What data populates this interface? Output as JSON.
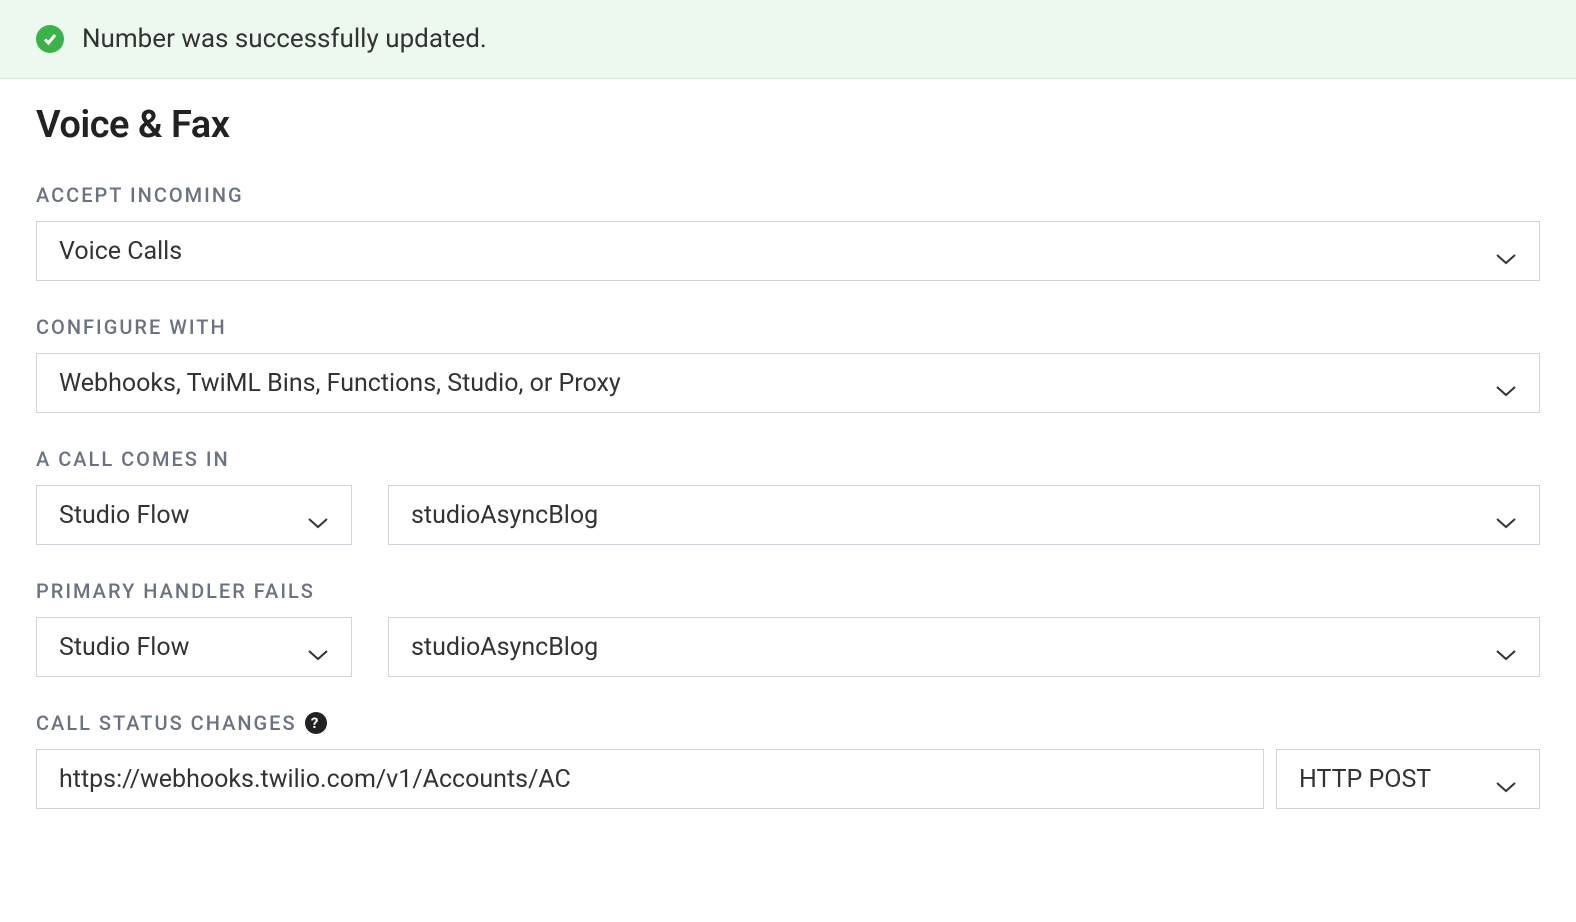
{
  "alert": {
    "message": "Number was successfully updated."
  },
  "section": {
    "title": "Voice & Fax"
  },
  "accept_incoming": {
    "label": "ACCEPT INCOMING",
    "value": "Voice Calls"
  },
  "configure_with": {
    "label": "CONFIGURE WITH",
    "value": "Webhooks, TwiML Bins, Functions, Studio, or Proxy"
  },
  "call_comes_in": {
    "label": "A CALL COMES IN",
    "handler_type": "Studio Flow",
    "handler_value": "studioAsyncBlog"
  },
  "primary_handler_fails": {
    "label": "PRIMARY HANDLER FAILS",
    "handler_type": "Studio Flow",
    "handler_value": "studioAsyncBlog"
  },
  "call_status_changes": {
    "label": "CALL STATUS CHANGES",
    "url": "https://webhooks.twilio.com/v1/Accounts/AC",
    "method": "HTTP POST"
  }
}
